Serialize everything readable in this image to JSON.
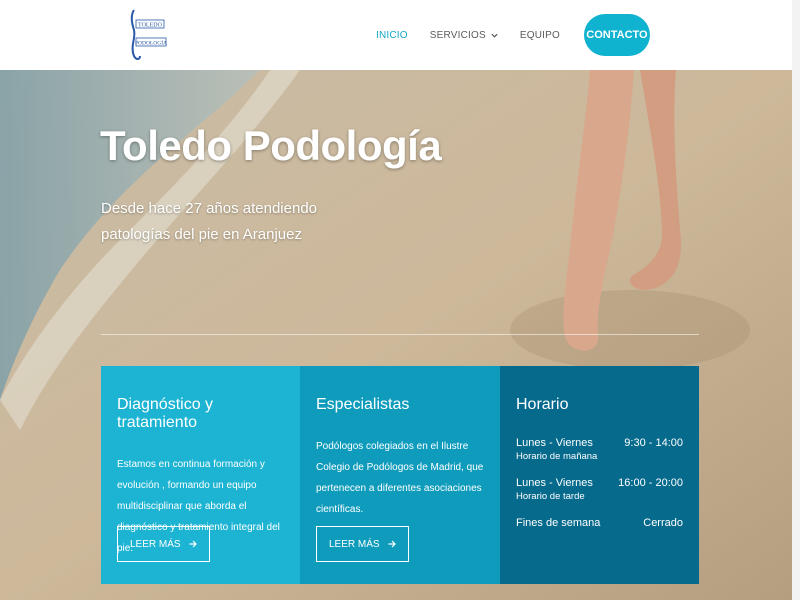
{
  "header": {
    "logo_text": [
      "TOLEDO",
      "PODOLOGÍA"
    ],
    "nav": [
      {
        "label": "INICIO",
        "active": true
      },
      {
        "label": "SERVICIOS",
        "has_dropdown": true
      },
      {
        "label": "EQUIPO"
      }
    ],
    "contact_label": "CONTACTO"
  },
  "hero": {
    "title": "Toledo Podología",
    "subtitle": "Desde hace 27 años atendiendo patologías del pie en Aranjuez"
  },
  "cards": [
    {
      "title": "Diagnóstico y tratamiento",
      "text": "Estamos en continua formación y evolución , formando un equipo multidisciplinar que aborda el diagnóstico y tratamiento integral del pie.",
      "button": "LEER MÁS"
    },
    {
      "title": "Especialistas",
      "text": "Podólogos colegiados en el Ilustre Colegio de Podólogos de Madrid, que pertenecen a diferentes asociaciones científicas.",
      "button": "LEER MÁS"
    },
    {
      "title": "Horario",
      "rows": [
        {
          "days": "Lunes - Viernes",
          "hours": "9:30 - 14:00",
          "note": "Horario de mañana"
        },
        {
          "days": "Lunes - Viernes",
          "hours": "16:00 - 20:00",
          "note": "Horario de tarde"
        },
        {
          "days": "Fines de semana",
          "hours": "Cerrado",
          "note": ""
        }
      ]
    }
  ],
  "colors": {
    "accent": "#10b3cf",
    "card1": "#1cb4d2",
    "card2": "#0f9cbc",
    "card3": "#066a8d"
  }
}
